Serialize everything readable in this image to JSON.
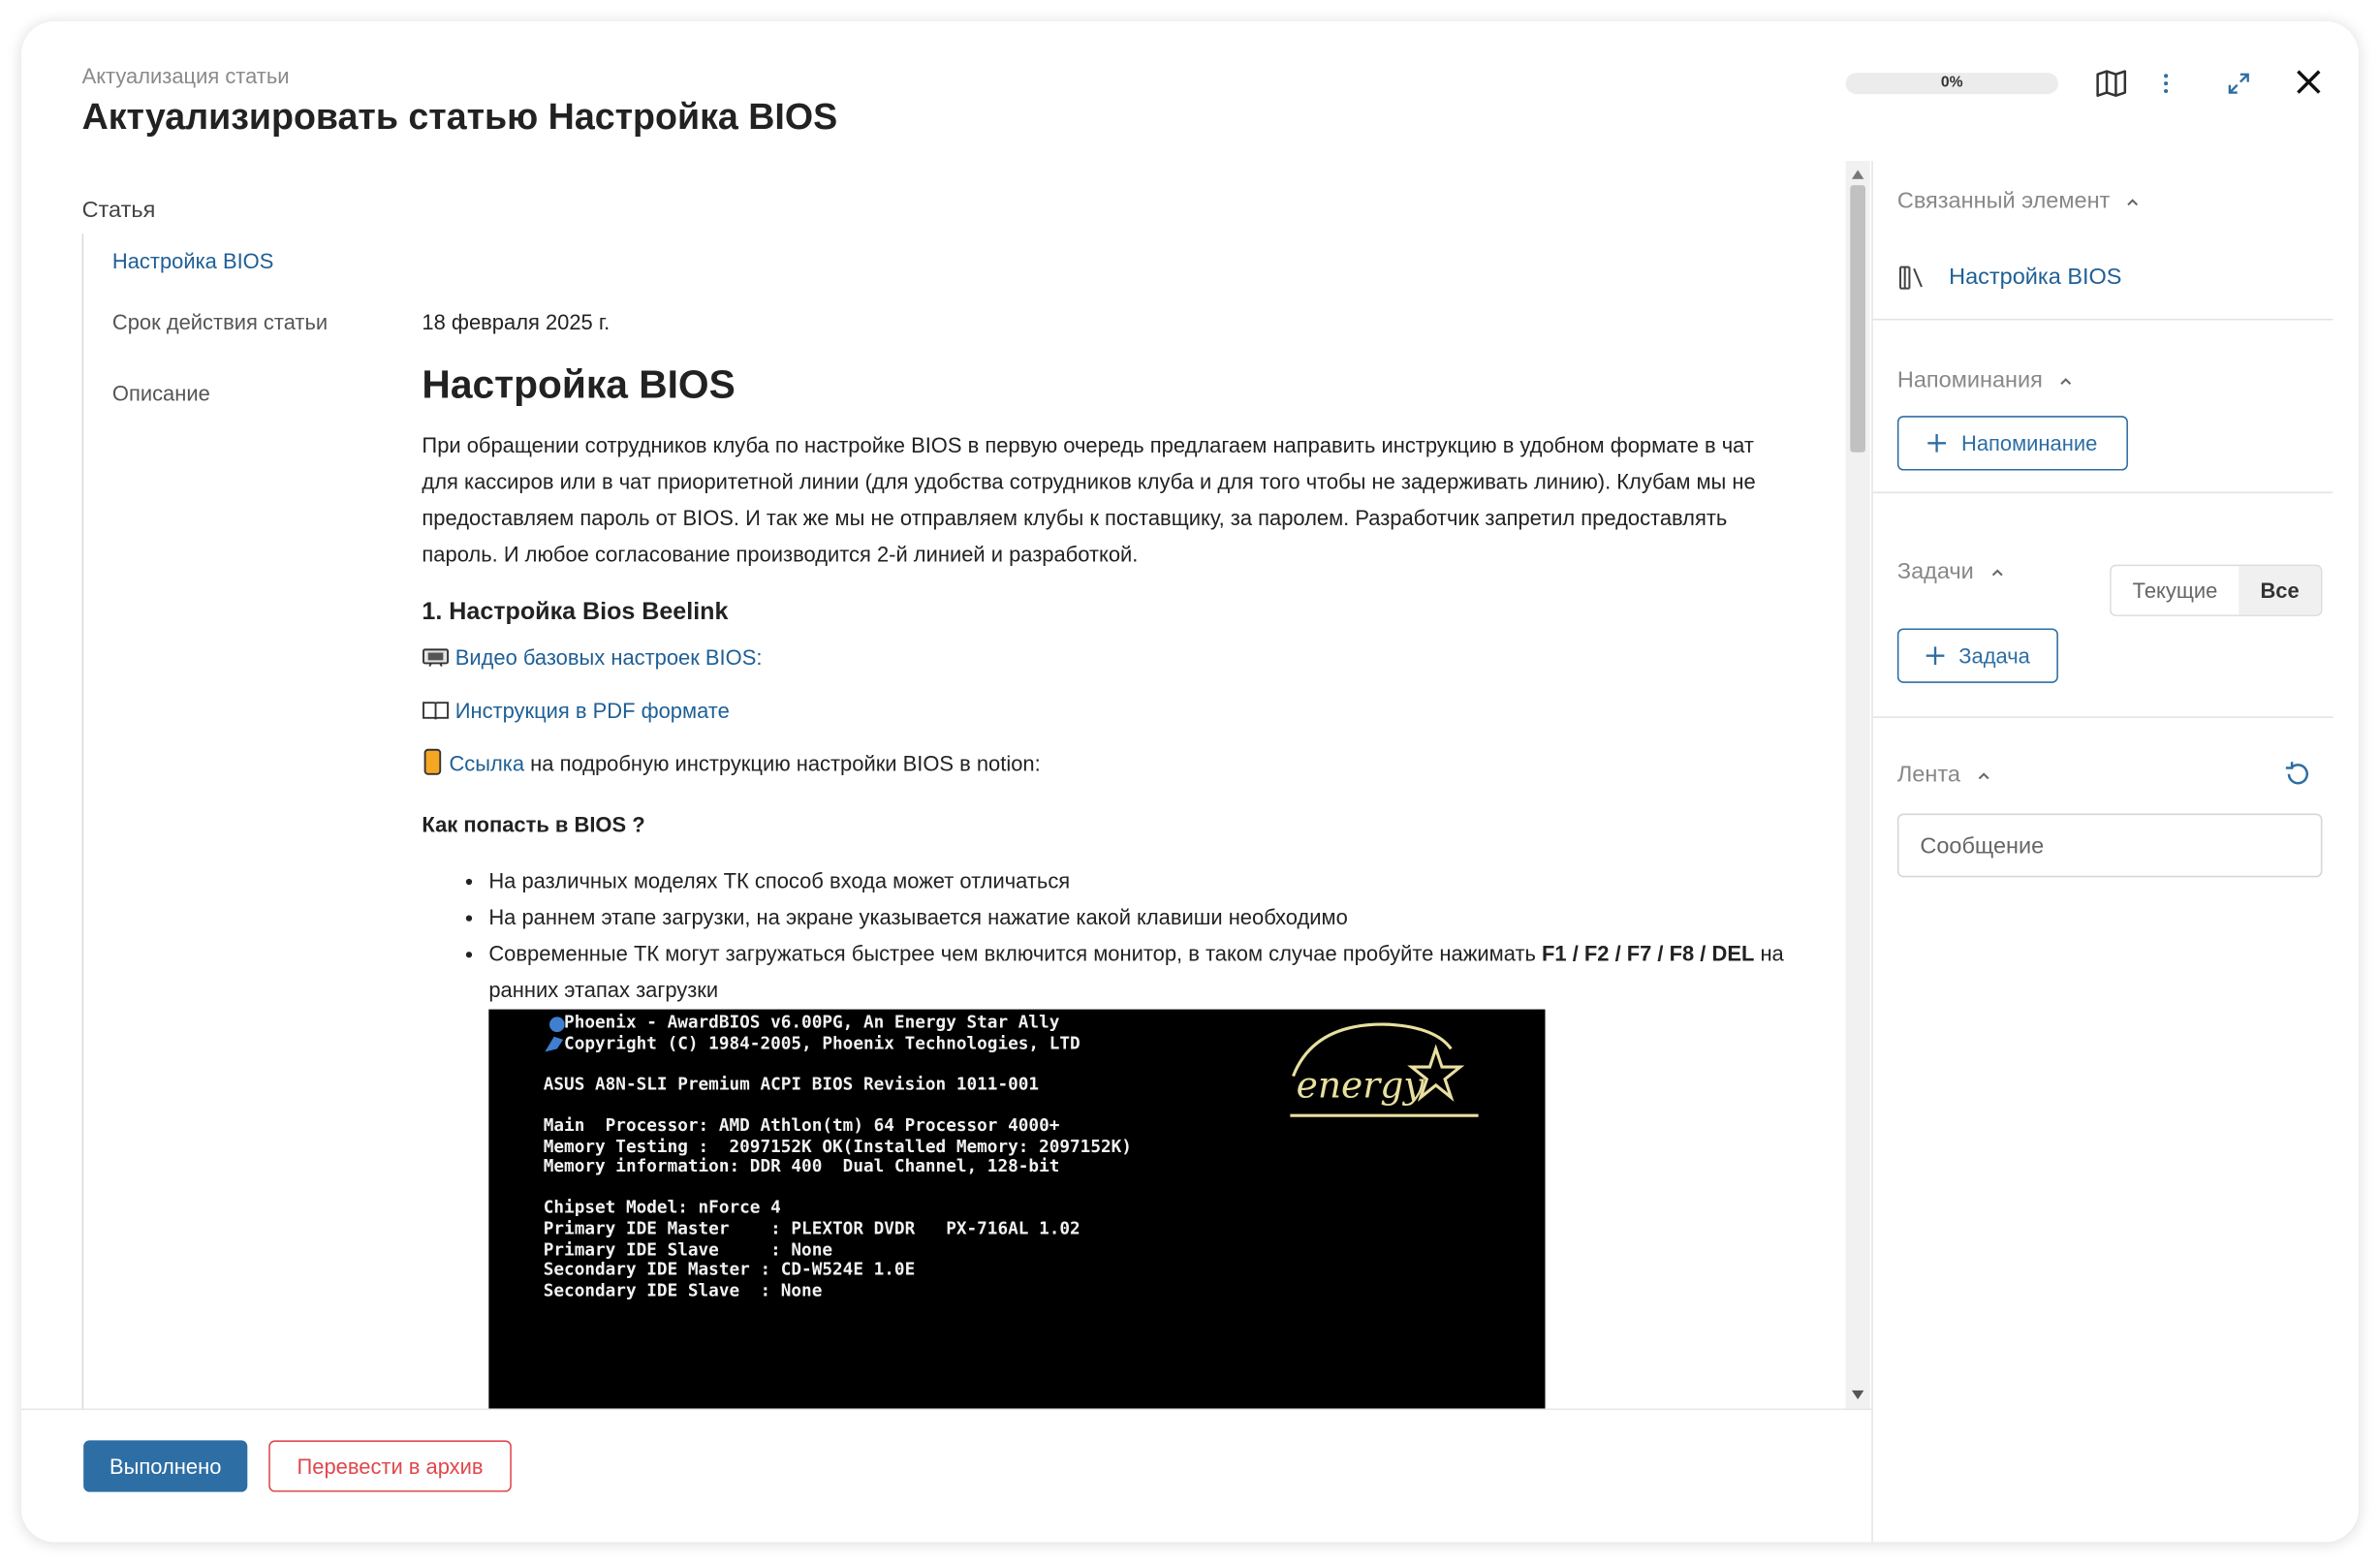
{
  "header": {
    "subtitle": "Актуализация статьи",
    "title": "Актуализировать статью Настройка BIOS",
    "progress_label": "0%",
    "progress_value": 0
  },
  "article": {
    "section_label": "Статья",
    "article_link": "Настройка BIOS",
    "expiry_label": "Срок действия статьи",
    "expiry_value": "18 февраля 2025 г.",
    "description_label": "Описание"
  },
  "description": {
    "heading": "Настройка BIOS",
    "intro": "При обращении сотрудников клуба по настройке BIOS в первую очередь предлагаем направить инструкцию в удобном формате в чат для кассиров или в чат приоритетной линии (для удобства сотрудников клуба и для того чтобы не задерживать линию). Клубам мы не предоставляем пароль от BIOS. И так же мы не отправляем клубы к поставщику, за паролем. Разработчик запретил предоставлять пароль. И любое согласование производится 2-й линией и разработкой.",
    "section1": "1. Настройка Bios Beelink",
    "video_link": "Видео базовых настроек BIOS:",
    "pdf_link": "Инструкция в PDF формате",
    "notion_link": "Ссылка",
    "notion_text": " на подробную инструкцию настройки BIOS в notion:",
    "how_to": "Как попасть в BIOS ?",
    "bullets": [
      "На различных моделях ТК способ входа может отличаться",
      "На раннем этапе загрузки, на экране указывается нажатие какой клавиши необходимо"
    ],
    "bullet3_before": "Современные ТК могут загружаться быстрее чем включится монитор, в таком случае пробуйте нажимать ",
    "bullet3_keys": "F1 / F2 / F7 / F8 / DEL",
    "bullet3_after": " на ранних этапах загрузки",
    "bios_lines": [
      "Phoenix - AwardBIOS v6.00PG, An Energy Star Ally",
      "Copyright (C) 1984-2005, Phoenix Technologies, LTD",
      "",
      "ASUS A8N-SLI Premium ACPI BIOS Revision 1011-001",
      "",
      "Main  Processor: AMD Athlon(tm) 64 Processor 4000+",
      "Memory Testing :  2097152K OK(Installed Memory: 2097152K)",
      "Memory information: DDR 400  Dual Channel, 128-bit",
      "",
      "Chipset Model: nForce 4",
      "Primary IDE Master    : PLEXTOR DVDR   PX-716AL 1.02",
      "Primary IDE Slave     : None",
      "Secondary IDE Master : CD-W524E 1.0E",
      "Secondary IDE Slave  : None"
    ],
    "bios_logo_text": "energy"
  },
  "footer": {
    "done_label": "Выполнено",
    "archive_label": "Перевести в архив"
  },
  "sidebar": {
    "related_heading": "Связанный элемент",
    "related_link": "Настройка BIOS",
    "reminders_heading": "Напоминания",
    "add_reminder": "Напоминание",
    "tasks_heading": "Задачи",
    "tasks_current": "Текущие",
    "tasks_all": "Все",
    "add_task": "Задача",
    "feed_heading": "Лента",
    "message_placeholder": "Сообщение"
  },
  "colors": {
    "accent": "#2d6ea4",
    "link": "#1f5f95",
    "danger": "#e0474c"
  }
}
